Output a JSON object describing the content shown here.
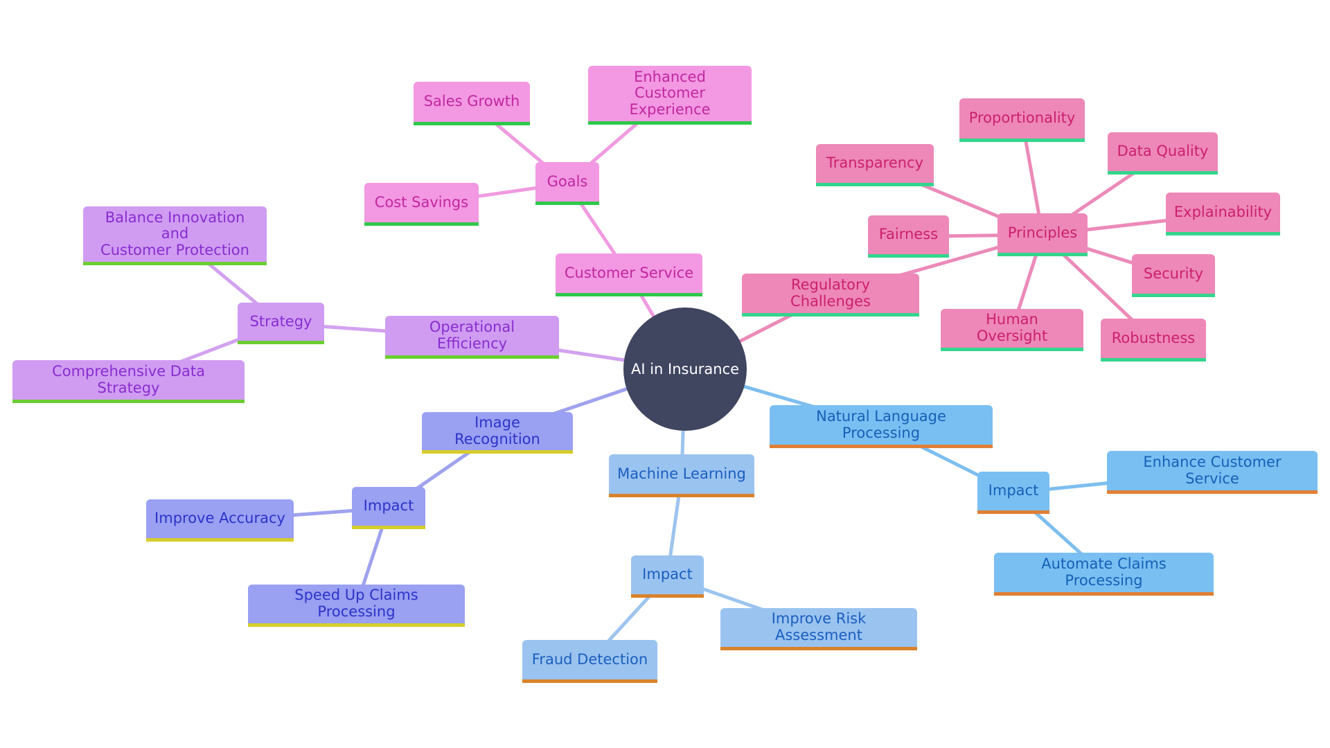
{
  "diagram": {
    "type": "mindmap",
    "root": {
      "id": "root",
      "label": "AI in Insurance"
    },
    "branches": {
      "customer_service": {
        "fill": "#f398e3",
        "text": "#c0279e",
        "underline": "#2ec94a",
        "edge": "#f09ae0"
      },
      "operational": {
        "fill": "#cf9cf2",
        "text": "#8a2ccf",
        "underline": "#6bcd32",
        "edge": "#d2a2f0"
      },
      "image": {
        "fill": "#9aa0f2",
        "text": "#2c33c8",
        "underline": "#d6cd2a",
        "edge": "#9ea2ee"
      },
      "ml": {
        "fill": "#9ac3f0",
        "text": "#1a5fbf",
        "underline": "#d9822a",
        "edge": "#9cc4ef"
      },
      "nlp": {
        "fill": "#7abff2",
        "text": "#1560b8",
        "underline": "#e07f33",
        "edge": "#7dbeef"
      },
      "regulatory": {
        "fill": "#ed88b8",
        "text": "#cc1f6e",
        "underline": "#34d58c",
        "edge": "#ec8ab8"
      }
    },
    "root_fill": "#404560",
    "nodes": [
      {
        "id": "cs",
        "label": "Customer Service",
        "branch": "customer_service",
        "parent": "root"
      },
      {
        "id": "goals",
        "label": "Goals",
        "branch": "customer_service",
        "parent": "cs"
      },
      {
        "id": "sales",
        "label": "Sales Growth",
        "branch": "customer_service",
        "parent": "goals"
      },
      {
        "id": "ece",
        "label": "Enhanced Customer\nExperience",
        "branch": "customer_service",
        "parent": "goals"
      },
      {
        "id": "cost",
        "label": "Cost Savings",
        "branch": "customer_service",
        "parent": "goals"
      },
      {
        "id": "oe",
        "label": "Operational Efficiency",
        "branch": "operational",
        "parent": "root"
      },
      {
        "id": "strategy",
        "label": "Strategy",
        "branch": "operational",
        "parent": "oe"
      },
      {
        "id": "balance",
        "label": "Balance Innovation and\nCustomer Protection",
        "branch": "operational",
        "parent": "strategy"
      },
      {
        "id": "cds",
        "label": "Comprehensive Data Strategy",
        "branch": "operational",
        "parent": "strategy"
      },
      {
        "id": "ir",
        "label": "Image Recognition",
        "branch": "image",
        "parent": "root"
      },
      {
        "id": "ir_impact",
        "label": "Impact",
        "branch": "image",
        "parent": "ir"
      },
      {
        "id": "accuracy",
        "label": "Improve Accuracy",
        "branch": "image",
        "parent": "ir_impact"
      },
      {
        "id": "speed",
        "label": "Speed Up Claims Processing",
        "branch": "image",
        "parent": "ir_impact"
      },
      {
        "id": "ml",
        "label": "Machine Learning",
        "branch": "ml",
        "parent": "root"
      },
      {
        "id": "ml_impact",
        "label": "Impact",
        "branch": "ml",
        "parent": "ml"
      },
      {
        "id": "fraud",
        "label": "Fraud Detection",
        "branch": "ml",
        "parent": "ml_impact"
      },
      {
        "id": "risk",
        "label": "Improve Risk Assessment",
        "branch": "ml",
        "parent": "ml_impact"
      },
      {
        "id": "nlp",
        "label": "Natural Language Processing",
        "branch": "nlp",
        "parent": "root"
      },
      {
        "id": "nlp_impact",
        "label": "Impact",
        "branch": "nlp",
        "parent": "nlp"
      },
      {
        "id": "ecs",
        "label": "Enhance Customer Service",
        "branch": "nlp",
        "parent": "nlp_impact"
      },
      {
        "id": "acp",
        "label": "Automate Claims Processing",
        "branch": "nlp",
        "parent": "nlp_impact"
      },
      {
        "id": "reg",
        "label": "Regulatory Challenges",
        "branch": "regulatory",
        "parent": "root"
      },
      {
        "id": "principles",
        "label": "Principles",
        "branch": "regulatory",
        "parent": "reg"
      },
      {
        "id": "transparency",
        "label": "Transparency",
        "branch": "regulatory",
        "parent": "principles"
      },
      {
        "id": "proportionality",
        "label": "Proportionality",
        "branch": "regulatory",
        "parent": "principles"
      },
      {
        "id": "dataquality",
        "label": "Data Quality",
        "branch": "regulatory",
        "parent": "principles"
      },
      {
        "id": "explainability",
        "label": "Explainability",
        "branch": "regulatory",
        "parent": "principles"
      },
      {
        "id": "fairness",
        "label": "Fairness",
        "branch": "regulatory",
        "parent": "principles"
      },
      {
        "id": "security",
        "label": "Security",
        "branch": "regulatory",
        "parent": "principles"
      },
      {
        "id": "oversight",
        "label": "Human Oversight",
        "branch": "regulatory",
        "parent": "principles"
      },
      {
        "id": "robustness",
        "label": "Robustness",
        "branch": "regulatory",
        "parent": "principles"
      }
    ]
  }
}
